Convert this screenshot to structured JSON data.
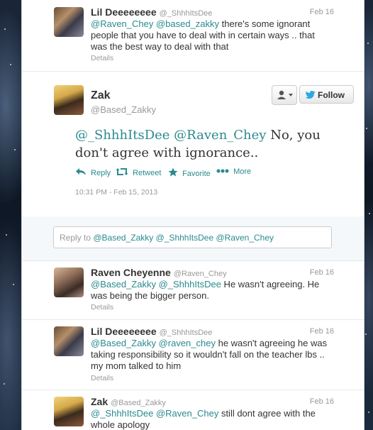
{
  "top_reply": {
    "name": "Lil Deeeeeeee",
    "handle": "@_ShhhItsDee",
    "date": "Feb 16",
    "text_mentions": "@Raven_Chey @based_zakky",
    "text_line1_rest": " there's some ignorant",
    "text_line2": "people that you have to deal with in certain ways .. that",
    "text_line3": "was the best way to deal with that",
    "details": "Details"
  },
  "main_tweet": {
    "name": "Zak",
    "handle": "@Based_Zakky",
    "follow_label": "Follow",
    "mention1": "@_ShhhItsDee",
    "mention2": "@Raven_Chey",
    "text_line1_rest": " No, you",
    "text_line2": "don't agree with ignorance..",
    "reply_label": "Reply",
    "retweet_label": "Retweet",
    "favorite_label": "Favorite",
    "more_label": "More",
    "timestamp": "10:31 PM - Feb 15, 2013"
  },
  "reply_box": {
    "prefix": "Reply to ",
    "mentions": "@Based_Zakky @_ShhhItsDee @Raven_Chey"
  },
  "replies": [
    {
      "name": "Raven Cheyenne",
      "handle": "@Raven_Chey",
      "date": "Feb 16",
      "mentions": "@Based_Zakky @_ShhhItsDee",
      "line1_rest": " He wasn't agreeing. He",
      "line2": "was being the bigger person.",
      "details": "Details"
    },
    {
      "name": "Lil Deeeeeeee",
      "handle": "@_ShhhItsDee",
      "date": "Feb 16",
      "mentions": "@Based_Zakky @raven_chey",
      "line1_rest": " he wasn't agreeing he was",
      "line2": "taking responsibility so it wouldn't fall on the teacher lbs ..",
      "line3": "my mom talked to him",
      "details": "Details"
    },
    {
      "name": "Zak",
      "handle": "@Based_Zakky",
      "date": "Feb 16",
      "mentions": "@_ShhhItsDee @Raven_Chey",
      "line1_rest": " still dont agree with the",
      "line2": "whole apology"
    }
  ],
  "colors": {
    "link": "#2a8a8e",
    "follow_bird": "#2aa9e0"
  },
  "icons": [
    "user-dropdown-icon",
    "twitter-bird-icon",
    "reply-icon",
    "retweet-icon",
    "favorite-star-icon",
    "more-dots-icon"
  ]
}
